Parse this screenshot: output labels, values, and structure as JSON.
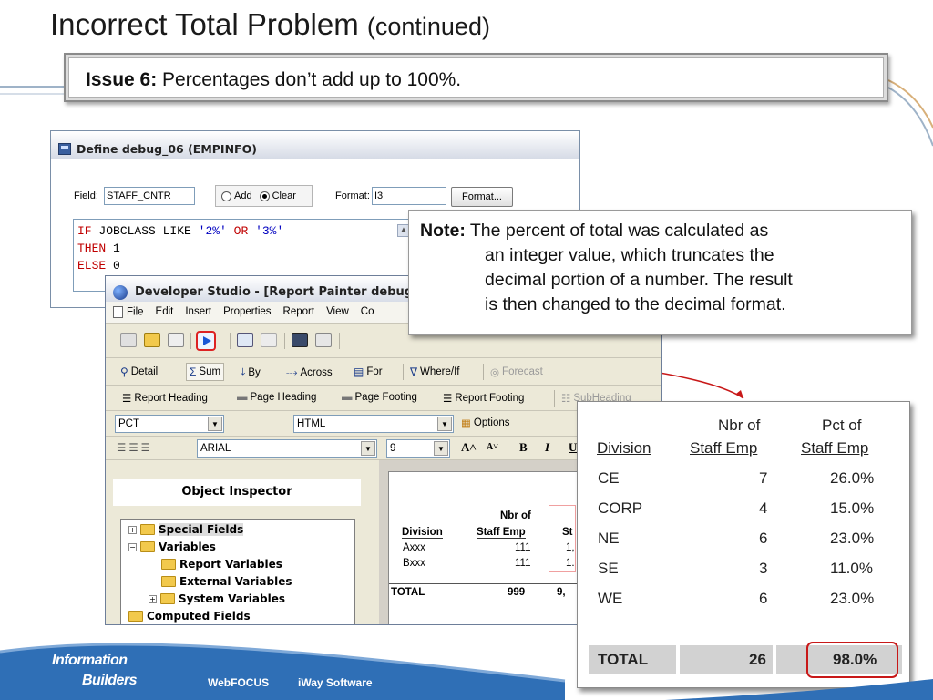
{
  "slide": {
    "title_main": "Incorrect Total Problem",
    "title_cont": "(continued)",
    "issue_label": "Issue 6:",
    "issue_text": " Percentages don’t add up to 100%."
  },
  "define_window": {
    "title": "Define debug_06 (EMPINFO)",
    "field_label": "Field:",
    "field_value": "STAFF_CNTR",
    "radio_add": "Add",
    "radio_clear": "Clear",
    "format_label": "Format:",
    "format_value": "I3",
    "format_button": "Format...",
    "code": {
      "l1_kw1": "IF",
      "l1_a": " JOBCLASS LIKE ",
      "l1_s1": "'2%'",
      "l1_kw2": " OR ",
      "l1_s2": "'3%'",
      "l2_kw": "THEN",
      "l2_v": " 1",
      "l3_kw": "ELSE",
      "l3_v": " 0"
    }
  },
  "dev_studio": {
    "title": "Developer Studio - [Report Painter debug",
    "menu": [
      "File",
      "Edit",
      "Insert",
      "Properties",
      "Report",
      "View",
      "Co"
    ],
    "toolbar2": {
      "detail": "Detail",
      "sum": "Sum",
      "by": "By",
      "across": "Across",
      "for": "For",
      "where_if": "Where/If",
      "forecast": "Forecast"
    },
    "toolbar3": {
      "report_heading": "Report Heading",
      "page_heading": "Page Heading",
      "page_footing": "Page Footing",
      "report_footing": "Report Footing",
      "subheading": "SubHeading"
    },
    "toolbar4": {
      "field_combo": "PCT",
      "output_combo": "HTML",
      "options": "Options"
    },
    "toolbar5": {
      "font_combo": "ARIAL",
      "size_combo": "9",
      "bold": "B",
      "italic": "I",
      "underline": "U"
    },
    "object_inspector": {
      "title": "Object Inspector",
      "tree": [
        "Special Fields",
        "Variables",
        "Report Variables",
        "External Variables",
        "System Variables",
        "Computed Fields"
      ]
    },
    "painter": {
      "h_nbr": "Nbr of",
      "h_division": "Division",
      "h_staff": "Staff Emp",
      "h_st": "St",
      "rows": [
        {
          "div": "Axxx",
          "nbr": "111",
          "pct": "1,"
        },
        {
          "div": "Bxxx",
          "nbr": "111",
          "pct": "1."
        }
      ],
      "total_label": "TOTAL",
      "total_nbr": "999",
      "total_pct": "9,"
    }
  },
  "note": {
    "label": "Note:",
    "line1": " The percent of total was calculated as",
    "line2": "an integer value, which truncates the",
    "line3": "decimal portion of a number. The result",
    "line4": "is then changed to the decimal format."
  },
  "report": {
    "h_nbr_1": "Nbr of",
    "h_nbr_2": "Staff Emp",
    "h_pct_1": "Pct of",
    "h_pct_2": "Staff Emp",
    "h_division": "Division",
    "rows": [
      {
        "division": "CE",
        "nbr": "7",
        "pct": "26.0%"
      },
      {
        "division": "CORP",
        "nbr": "4",
        "pct": "15.0%"
      },
      {
        "division": "NE",
        "nbr": "6",
        "pct": "23.0%"
      },
      {
        "division": "SE",
        "nbr": "3",
        "pct": "11.0%"
      },
      {
        "division": "WE",
        "nbr": "6",
        "pct": "23.0%"
      }
    ],
    "total_label": "TOTAL",
    "total_nbr": "26",
    "total_pct": "98.0%"
  },
  "footer": {
    "logo_line1": "Information",
    "logo_line2": "Builders",
    "link1": "WebFOCUS",
    "link2": "iWay Software"
  },
  "colors": {
    "footer_blue": "#2f6fb6",
    "highlight_red": "#c81818",
    "code_keyword": "#c00000",
    "code_string": "#0000c0"
  }
}
